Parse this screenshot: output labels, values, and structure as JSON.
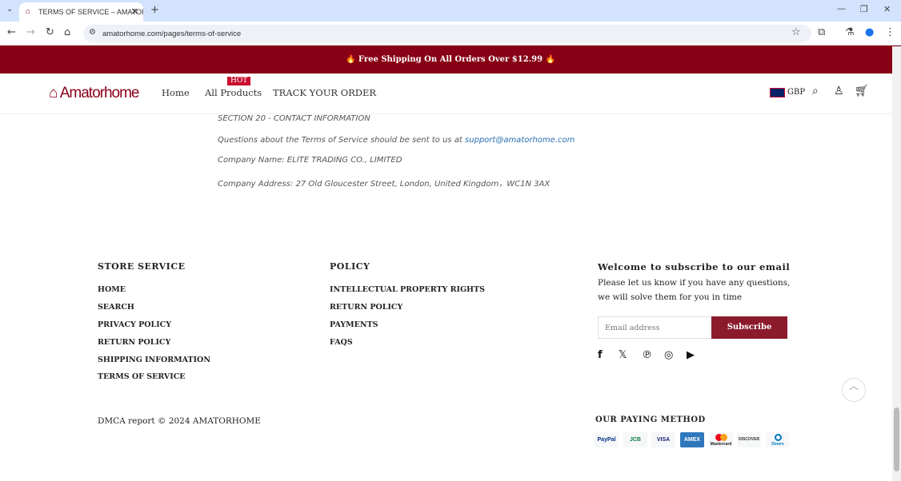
{
  "browser": {
    "tab_title": "TERMS OF SERVICE – AMATORHOME",
    "url": "amatorhome.com/pages/terms-of-service"
  },
  "banner": {
    "text": "🔥 Free Shipping On All Orders Over $12.99 🔥"
  },
  "header": {
    "logo": "Amatorhome",
    "nav": [
      "Home",
      "All Products",
      "TRACK YOUR ORDER"
    ],
    "hot_badge": "HOT",
    "currency": "GBP"
  },
  "content": {
    "section_title": "SECTION 20 - CONTACT INFORMATION",
    "questions": "Questions about the Terms of Service should be sent to us at ",
    "email": "support@amatorhome.com",
    "company_name": "Company Name: ELITE TRADING CO., LIMITED",
    "company_address": "Company Address: 27 Old Gloucester Street, London, United Kingdom，WC1N 3AX"
  },
  "footer": {
    "store_service": {
      "title": "STORE SERVICE",
      "items": [
        "HOME",
        "SEARCH",
        "PRIVACY POLICY",
        "RETURN POLICY",
        "SHIPPING INFORMATION",
        "TERMS OF SERVICE"
      ]
    },
    "policy": {
      "title": "POLICY",
      "items": [
        "INTELLECTUAL PROPERTY RIGHTS",
        "RETURN POLICY",
        "PAYMENTS",
        "FAQS"
      ]
    },
    "subscribe": {
      "title": "Welcome to subscribe to our email",
      "text1": "Please let us know if you have any questions,",
      "text2": "we will solve them for you in time",
      "placeholder": "Email address",
      "button": "Subscribe"
    },
    "social": [
      "facebook",
      "x",
      "pinterest",
      "instagram",
      "youtube"
    ],
    "copyright": "DMCA report © 2024 AMATORHOME",
    "paying_title": "OUR PAYING METHOD",
    "payments": [
      "PayPal",
      "JCB",
      "VISA",
      "AMEX",
      "Mastercard",
      "DISCOVER",
      "Diners"
    ]
  },
  "colors": {
    "brand": "#870015",
    "link": "#2a6fb0"
  }
}
